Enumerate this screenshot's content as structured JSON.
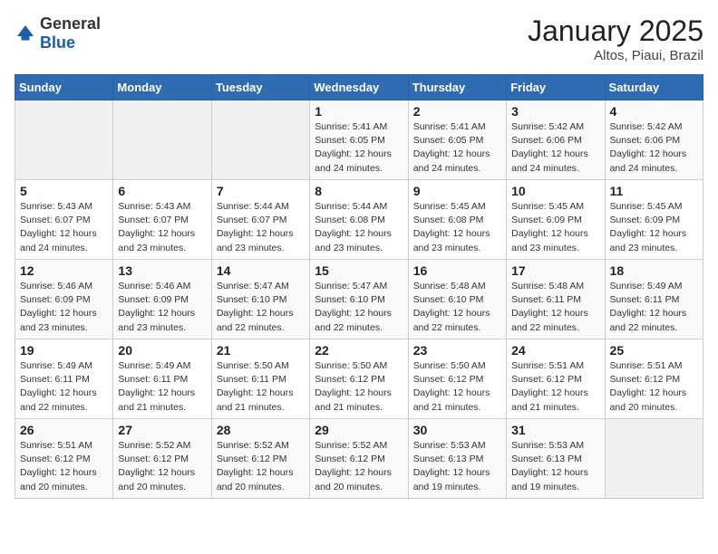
{
  "header": {
    "logo_general": "General",
    "logo_blue": "Blue",
    "month": "January 2025",
    "location": "Altos, Piaui, Brazil"
  },
  "weekdays": [
    "Sunday",
    "Monday",
    "Tuesday",
    "Wednesday",
    "Thursday",
    "Friday",
    "Saturday"
  ],
  "weeks": [
    [
      {
        "day": "",
        "empty": true
      },
      {
        "day": "",
        "empty": true
      },
      {
        "day": "",
        "empty": true
      },
      {
        "day": "1",
        "sunrise": "5:41 AM",
        "sunset": "6:05 PM",
        "daylight": "12 hours and 24 minutes."
      },
      {
        "day": "2",
        "sunrise": "5:41 AM",
        "sunset": "6:05 PM",
        "daylight": "12 hours and 24 minutes."
      },
      {
        "day": "3",
        "sunrise": "5:42 AM",
        "sunset": "6:06 PM",
        "daylight": "12 hours and 24 minutes."
      },
      {
        "day": "4",
        "sunrise": "5:42 AM",
        "sunset": "6:06 PM",
        "daylight": "12 hours and 24 minutes."
      }
    ],
    [
      {
        "day": "5",
        "sunrise": "5:43 AM",
        "sunset": "6:07 PM",
        "daylight": "12 hours and 24 minutes."
      },
      {
        "day": "6",
        "sunrise": "5:43 AM",
        "sunset": "6:07 PM",
        "daylight": "12 hours and 23 minutes."
      },
      {
        "day": "7",
        "sunrise": "5:44 AM",
        "sunset": "6:07 PM",
        "daylight": "12 hours and 23 minutes."
      },
      {
        "day": "8",
        "sunrise": "5:44 AM",
        "sunset": "6:08 PM",
        "daylight": "12 hours and 23 minutes."
      },
      {
        "day": "9",
        "sunrise": "5:45 AM",
        "sunset": "6:08 PM",
        "daylight": "12 hours and 23 minutes."
      },
      {
        "day": "10",
        "sunrise": "5:45 AM",
        "sunset": "6:09 PM",
        "daylight": "12 hours and 23 minutes."
      },
      {
        "day": "11",
        "sunrise": "5:45 AM",
        "sunset": "6:09 PM",
        "daylight": "12 hours and 23 minutes."
      }
    ],
    [
      {
        "day": "12",
        "sunrise": "5:46 AM",
        "sunset": "6:09 PM",
        "daylight": "12 hours and 23 minutes."
      },
      {
        "day": "13",
        "sunrise": "5:46 AM",
        "sunset": "6:09 PM",
        "daylight": "12 hours and 23 minutes."
      },
      {
        "day": "14",
        "sunrise": "5:47 AM",
        "sunset": "6:10 PM",
        "daylight": "12 hours and 22 minutes."
      },
      {
        "day": "15",
        "sunrise": "5:47 AM",
        "sunset": "6:10 PM",
        "daylight": "12 hours and 22 minutes."
      },
      {
        "day": "16",
        "sunrise": "5:48 AM",
        "sunset": "6:10 PM",
        "daylight": "12 hours and 22 minutes."
      },
      {
        "day": "17",
        "sunrise": "5:48 AM",
        "sunset": "6:11 PM",
        "daylight": "12 hours and 22 minutes."
      },
      {
        "day": "18",
        "sunrise": "5:49 AM",
        "sunset": "6:11 PM",
        "daylight": "12 hours and 22 minutes."
      }
    ],
    [
      {
        "day": "19",
        "sunrise": "5:49 AM",
        "sunset": "6:11 PM",
        "daylight": "12 hours and 22 minutes."
      },
      {
        "day": "20",
        "sunrise": "5:49 AM",
        "sunset": "6:11 PM",
        "daylight": "12 hours and 21 minutes."
      },
      {
        "day": "21",
        "sunrise": "5:50 AM",
        "sunset": "6:11 PM",
        "daylight": "12 hours and 21 minutes."
      },
      {
        "day": "22",
        "sunrise": "5:50 AM",
        "sunset": "6:12 PM",
        "daylight": "12 hours and 21 minutes."
      },
      {
        "day": "23",
        "sunrise": "5:50 AM",
        "sunset": "6:12 PM",
        "daylight": "12 hours and 21 minutes."
      },
      {
        "day": "24",
        "sunrise": "5:51 AM",
        "sunset": "6:12 PM",
        "daylight": "12 hours and 21 minutes."
      },
      {
        "day": "25",
        "sunrise": "5:51 AM",
        "sunset": "6:12 PM",
        "daylight": "12 hours and 20 minutes."
      }
    ],
    [
      {
        "day": "26",
        "sunrise": "5:51 AM",
        "sunset": "6:12 PM",
        "daylight": "12 hours and 20 minutes."
      },
      {
        "day": "27",
        "sunrise": "5:52 AM",
        "sunset": "6:12 PM",
        "daylight": "12 hours and 20 minutes."
      },
      {
        "day": "28",
        "sunrise": "5:52 AM",
        "sunset": "6:12 PM",
        "daylight": "12 hours and 20 minutes."
      },
      {
        "day": "29",
        "sunrise": "5:52 AM",
        "sunset": "6:12 PM",
        "daylight": "12 hours and 20 minutes."
      },
      {
        "day": "30",
        "sunrise": "5:53 AM",
        "sunset": "6:13 PM",
        "daylight": "12 hours and 19 minutes."
      },
      {
        "day": "31",
        "sunrise": "5:53 AM",
        "sunset": "6:13 PM",
        "daylight": "12 hours and 19 minutes."
      },
      {
        "day": "",
        "empty": true
      }
    ]
  ]
}
